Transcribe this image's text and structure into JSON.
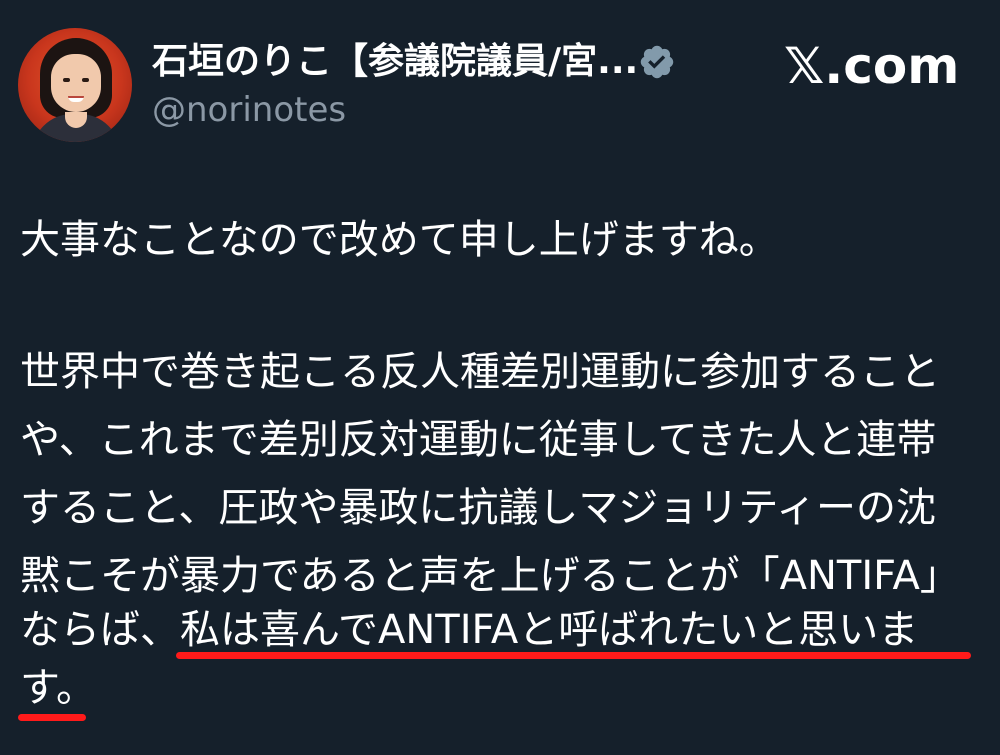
{
  "header": {
    "display_name": "石垣のりこ【参議院議員/宮...",
    "handle": "@norinotes",
    "brand": "𝕏.com",
    "verified_color": "#829aab"
  },
  "post": {
    "line1": "大事なことなので改めて申し上げますね。",
    "para2": [
      "世界中で巻き起こる反人種差別運動に参加すること",
      "や、これまで差別反対運動に従事してきた人と連帯",
      "すること、圧政や暴政に抗議しマジョリティーの沈",
      "黙こそが暴力であると声を上げることが「ANTIFA」"
    ],
    "line_last_prefix": "ならば、",
    "line_last_highlight": "私は喜んでANTIFAと呼ばれたいと思いま",
    "line_end": "す。"
  },
  "colors": {
    "background": "#15202b",
    "text": "#ffffff",
    "muted": "#8b98a5",
    "annotation": "#ff1a1a"
  }
}
